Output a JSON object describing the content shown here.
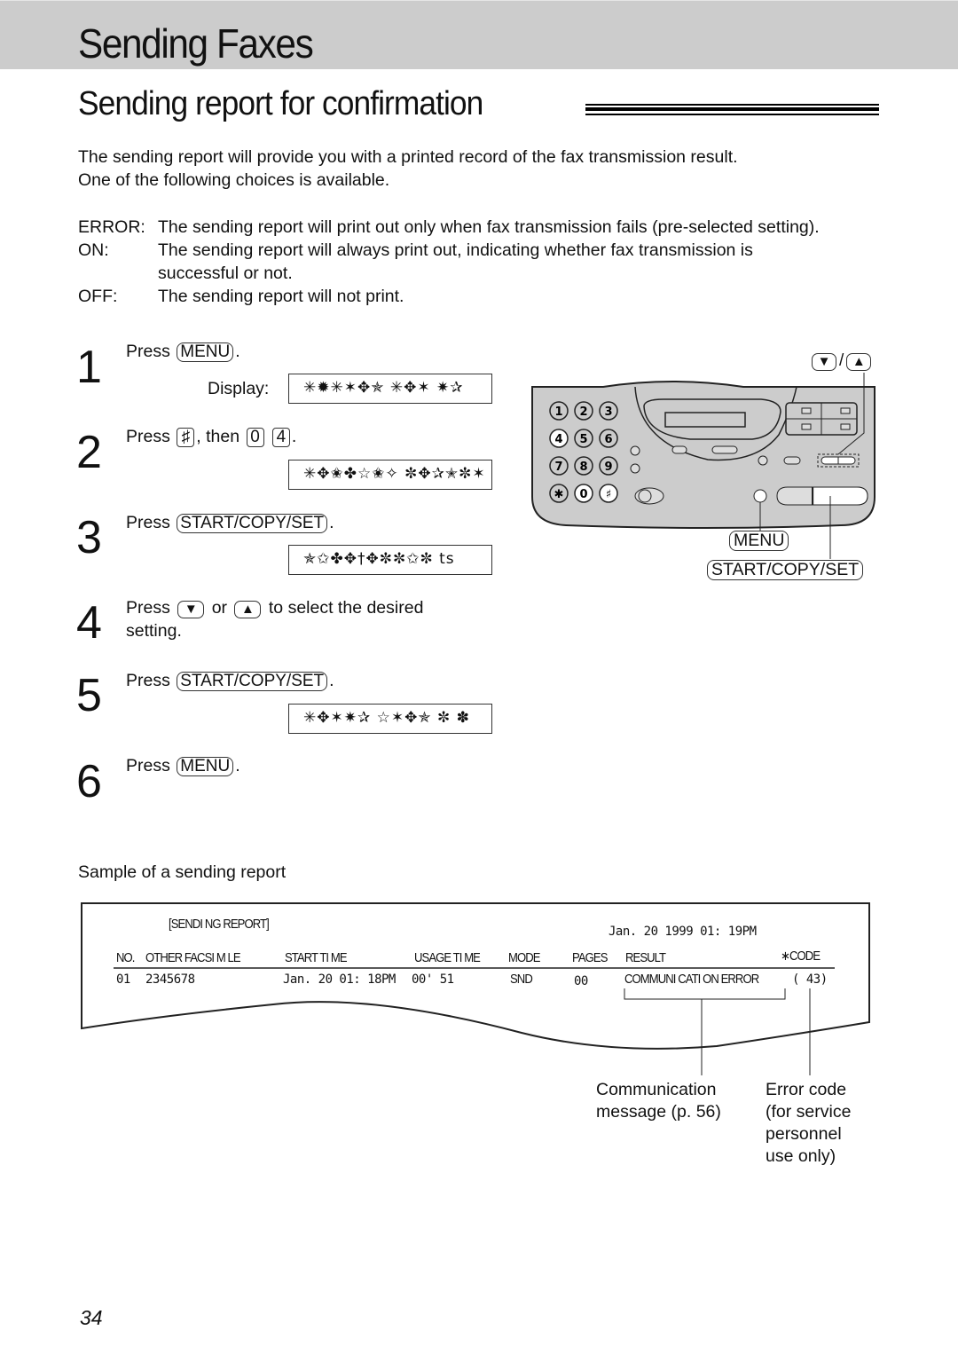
{
  "header": {
    "title": "Sending Faxes"
  },
  "section": {
    "title": "Sending report for confirmation"
  },
  "intro": {
    "line1": "The sending report will provide you with a printed record of the fax transmission result.",
    "line2": "One of the following choices is available."
  },
  "options": [
    {
      "label": "ERROR:",
      "text": "The sending report will print out only when fax transmission fails (pre-selected setting)."
    },
    {
      "label": "ON:",
      "text": "The sending report will always print out, indicating whether fax transmission is",
      "text2": "successful or not."
    },
    {
      "label": "OFF:",
      "text": "The sending report will not print."
    }
  ],
  "steps": [
    {
      "num": "1",
      "press": "Press",
      "key": "MENU",
      "end": ".",
      "display_label": "Display:",
      "display": "✳✹✳✶✥✯ ✳✥✶ ✷✰"
    },
    {
      "num": "2",
      "press": "Press",
      "key1": "♯",
      "then": ", then",
      "key2": "0",
      "key3": "4",
      "end": ".",
      "display": "✳✥✬✤☆✬✧ ✼✥✰✭✼✶"
    },
    {
      "num": "3",
      "press": "Press",
      "key": "START/COPY/SET",
      "end": ".",
      "display": "✯✩✤✥†✥✼✼✩✼ ts"
    },
    {
      "num": "4",
      "press": "Press",
      "key_down": "▼",
      "or": "or",
      "key_up": "▲",
      "rest": "to select the desired",
      "rest2": "setting."
    },
    {
      "num": "5",
      "press": "Press",
      "key": "START/COPY/SET",
      "end": ".",
      "display": "✳✥✶✷✰ ☆✶✥✯ ✼  ✽"
    },
    {
      "num": "6",
      "press": "Press",
      "key": "MENU",
      "end": "."
    }
  ],
  "fax_panel": {
    "keypad": [
      "1",
      "2",
      "3",
      "4",
      "5",
      "6",
      "7",
      "8",
      "9",
      "✱",
      "0",
      "♯"
    ],
    "highlighted_keys": [
      "4",
      "0",
      "♯"
    ],
    "arrow_labels": {
      "down": "▼",
      "slash": "/",
      "up": "▲"
    },
    "menu_label": "MENU",
    "start_label": "START/COPY/SET"
  },
  "sample": {
    "label": "Sample of a sending report",
    "report": {
      "title": "[SENDI NG REPORT]",
      "datetime": "Jan.  20  1999  01: 19PM",
      "columns": [
        "NO.",
        "OTHER FACSI M LE",
        "START  TI ME",
        "USAGE  TI ME",
        "MODE",
        "PAGES",
        "RESULT",
        "∗CODE"
      ],
      "row": {
        "no": "01",
        "other": "2345678",
        "start": "Jan.  20  01: 18PM",
        "usage": "00' 51",
        "mode": "SND",
        "pages": "00",
        "result": "COMMUNI CATI ON  ERROR",
        "code": "( 43)"
      }
    },
    "callouts": {
      "comm_1": "Communication",
      "comm_2": "message (p. 56)",
      "err_1": "Error code",
      "err_2": "(for service",
      "err_3": "personnel",
      "err_4": "use only)"
    }
  },
  "page_number": "34"
}
